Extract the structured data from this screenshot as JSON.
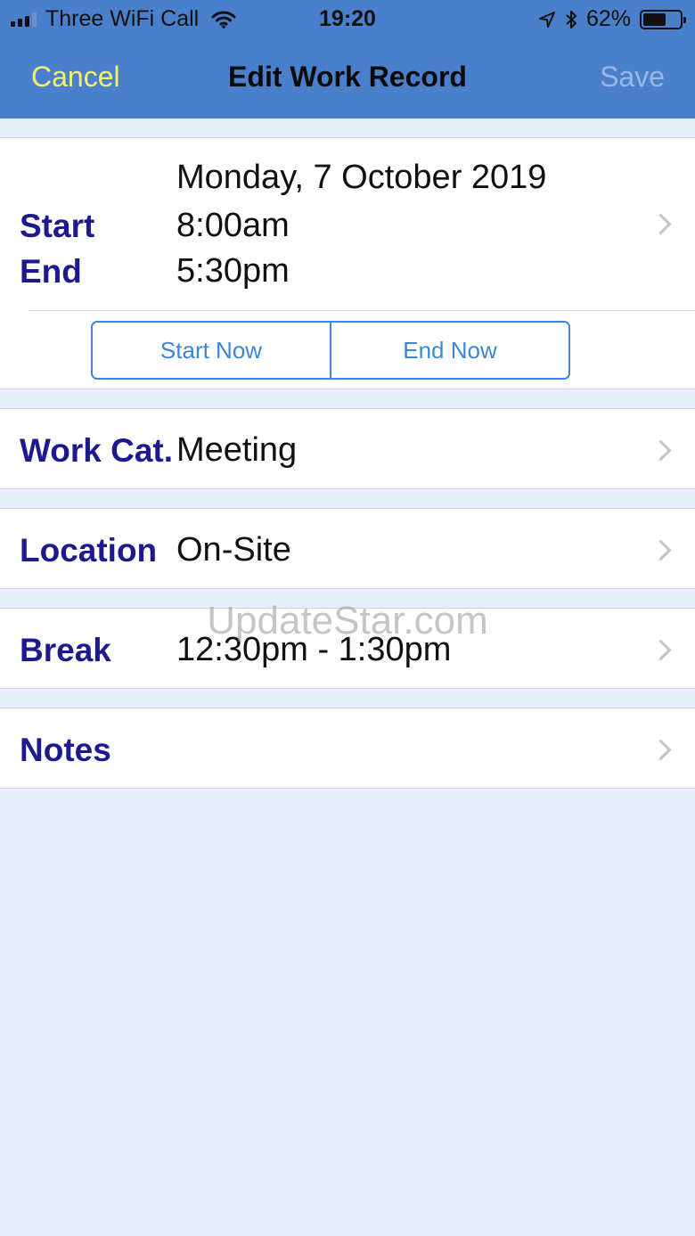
{
  "status_bar": {
    "carrier": "Three WiFi Call",
    "time": "19:20",
    "battery": "62%",
    "battery_level": 0.62
  },
  "nav": {
    "cancel_label": "Cancel",
    "title": "Edit Work Record",
    "save_label": "Save"
  },
  "time_section": {
    "date": "Monday, 7 October 2019",
    "start_label": "Start",
    "start_value": "8:00am",
    "end_label": "End",
    "end_value": "5:30pm",
    "start_now_label": "Start Now",
    "end_now_label": "End Now"
  },
  "rows": {
    "work_cat": {
      "label": "Work Cat.",
      "value": "Meeting"
    },
    "location": {
      "label": "Location",
      "value": "On-Site"
    },
    "break": {
      "label": "Break",
      "value": "12:30pm - 1:30pm"
    },
    "notes": {
      "label": "Notes",
      "value": ""
    }
  },
  "watermark": "UpdateStar.com",
  "colors": {
    "nav_bg": "#4a7fcb",
    "cancel": "#f4f36a",
    "save_disabled": "#9bb7e2",
    "label": "#1c1a8c",
    "segment": "#3c85d9",
    "background": "#e6f0fd"
  }
}
